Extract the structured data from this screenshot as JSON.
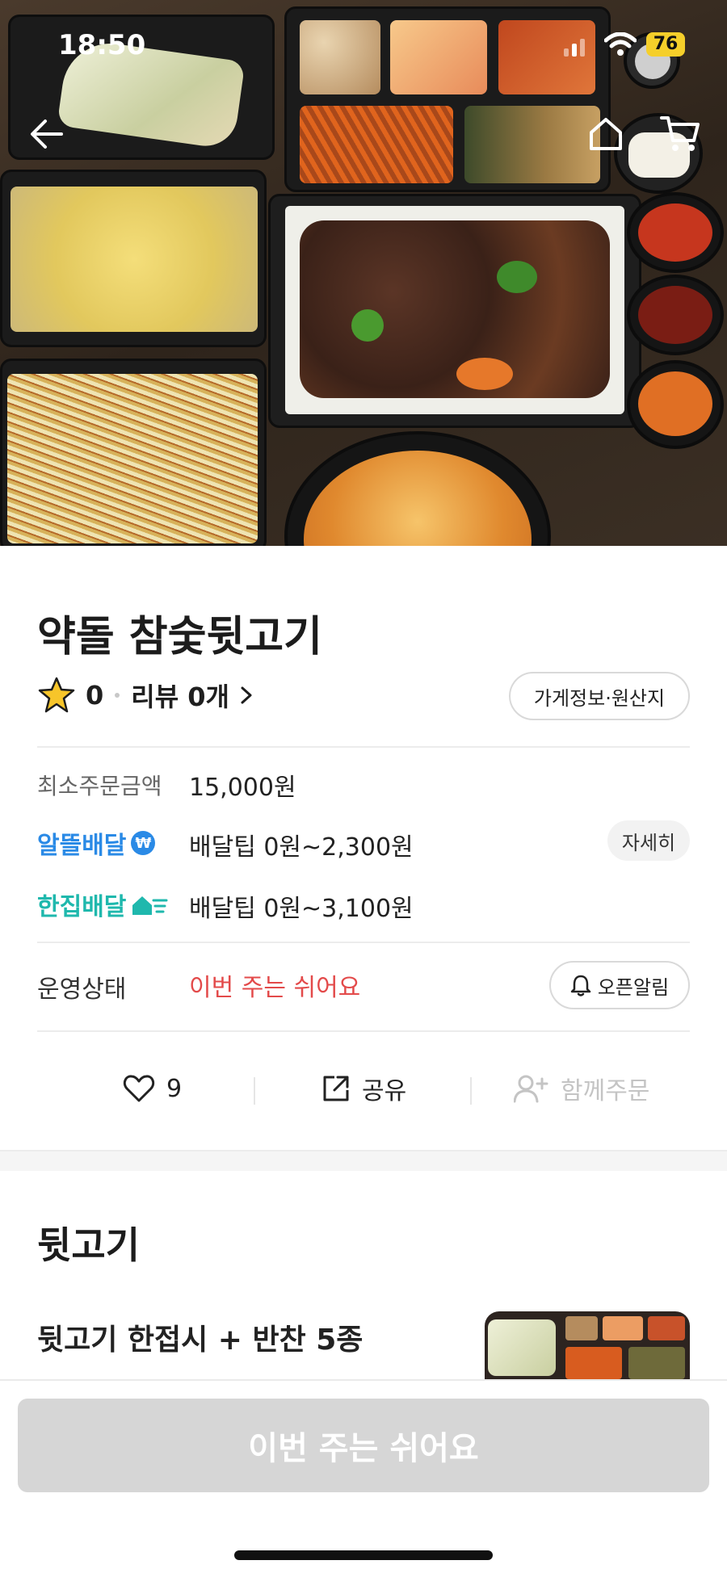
{
  "status_bar": {
    "time": "18:50",
    "battery": "76"
  },
  "store": {
    "name": "약돌 참숯뒷고기",
    "rating": "0",
    "review_label": "리뷰 0개",
    "info_button": "가게정보·원산지"
  },
  "order_info": {
    "min_order_label": "최소주문금액",
    "min_order_value": "15,000원",
    "delivery_options": [
      {
        "brand": "알뜰배달",
        "tip": "배달팁 0원~2,300원",
        "color": "#2a8ae6"
      },
      {
        "brand": "한집배달",
        "tip": "배달팁 0원~3,100원",
        "color": "#1fb8ad"
      }
    ],
    "detail_button": "자세히",
    "status_label": "운영상태",
    "status_value": "이번 주는 쉬어요",
    "status_color": "#e34a4a",
    "open_alert_button": "오픈알림"
  },
  "actions": {
    "like_count": "9",
    "share_label": "공유",
    "group_order_label": "함께주문"
  },
  "menu": {
    "section_title": "뒷고기",
    "items": [
      {
        "name": "뒷고기 한접시 + 반찬 5종"
      }
    ]
  },
  "bottom": {
    "cta_label": "이번 주는 쉬어요"
  }
}
